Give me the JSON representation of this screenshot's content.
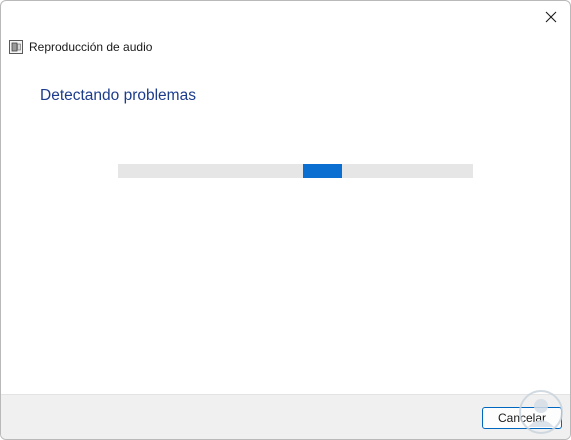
{
  "window": {
    "app_title": "Reproducción de audio",
    "icons": {
      "close": "close-icon",
      "app": "audio-troubleshooter-icon"
    }
  },
  "main": {
    "heading": "Detectando problemas",
    "progress": {
      "mode": "indeterminate",
      "accent_color": "#0a6fd0",
      "track_color": "#e6e6e6"
    }
  },
  "footer": {
    "cancel_label": "Cancelar"
  },
  "colors": {
    "heading": "#1c3c8c",
    "footer_bg": "#f0f0f0",
    "button_border": "#0067c0"
  }
}
